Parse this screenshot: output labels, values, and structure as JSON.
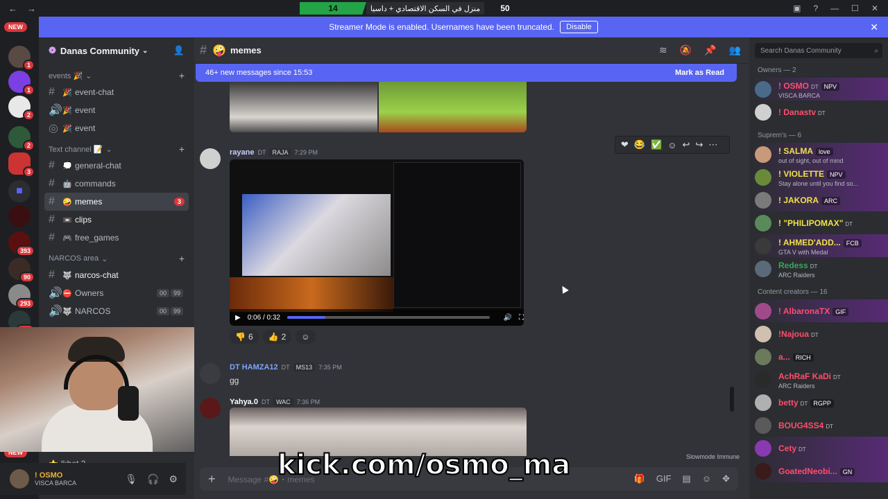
{
  "titlebar": {
    "score_left": "14",
    "stream_title": "منزل في السكن الاقتصادي + داسيا",
    "score_right": "50"
  },
  "banner": {
    "text": "Streamer Mode is enabled. Usernames have been truncated.",
    "disable_label": "Disable"
  },
  "servers": {
    "new_top": "NEW",
    "new_bottom": "NEW",
    "badges": [
      "1",
      "1",
      "2",
      "2",
      "3",
      "393",
      "90",
      "293",
      "230"
    ]
  },
  "guild": {
    "name": "Danas Community",
    "categories": [
      {
        "label": "events 🎉",
        "channels": [
          {
            "name": "event-chat",
            "emoji": "🎉",
            "type": "text"
          },
          {
            "name": "event",
            "emoji": "🎉",
            "type": "voice"
          },
          {
            "name": "event",
            "emoji": "🎉",
            "type": "stage"
          }
        ]
      },
      {
        "label": "Text channel 📝",
        "channels": [
          {
            "name": "general-chat",
            "emoji": "💭",
            "type": "text"
          },
          {
            "name": "commands",
            "emoji": "🤖",
            "type": "text"
          },
          {
            "name": "memes",
            "emoji": "🤪",
            "type": "text",
            "mention": "3"
          },
          {
            "name": "clips",
            "emoji": "📼",
            "type": "text"
          },
          {
            "name": "free_games",
            "emoji": "🎮",
            "type": "text"
          }
        ]
      },
      {
        "label": "NARCOS area",
        "channels": [
          {
            "name": "narcos-chat",
            "emoji": "🐺",
            "type": "text"
          },
          {
            "name": "Owners",
            "emoji": "⛔",
            "type": "voice",
            "users": "00",
            "limit": "99"
          },
          {
            "name": "NARCOS",
            "emoji": "🐺",
            "type": "voice",
            "users": "00",
            "limit": "99"
          }
        ]
      }
    ],
    "bottom_channel": "lkhot 2"
  },
  "user_panel": {
    "name": "! OSMO",
    "status": "VISCA BARCA"
  },
  "channel": {
    "name": "memes",
    "new_messages": "46+ new messages since 15:53",
    "mark_read": "Mark as Read"
  },
  "messages": [
    {
      "author": "rayane",
      "suffix": "DT",
      "tag": "RAJA",
      "time": "7:29 PM",
      "author_color": "#c9cdfb"
    },
    {
      "author": "DT HAMZA12",
      "suffix": "DT",
      "tag": "MS13",
      "time": "7:35 PM",
      "text": "gg",
      "author_color": "#7ea6ff"
    },
    {
      "author": "Yahya.0",
      "suffix": "DT",
      "tag": "WAC",
      "time": "7:36 PM",
      "author_color": "#ffffff"
    }
  ],
  "video": {
    "time": "0:06 / 0:32",
    "progress": 0.19
  },
  "reactions": [
    {
      "emoji": "👎",
      "count": "6"
    },
    {
      "emoji": "👍",
      "count": "2"
    }
  ],
  "slowmode": "Slowmode Immune",
  "composer": {
    "placeholder": "Message #🤪・memes"
  },
  "overlay": {
    "kick": "kick.com/osmo_ma"
  },
  "members": {
    "search_placeholder": "Search Danas Community",
    "groups": [
      {
        "label": "Owners — 2",
        "items": [
          {
            "name": "! OSMO",
            "suffix": "DT",
            "tag": "NPV",
            "status": "VISCA BARCA",
            "color": "#ff4d6d",
            "glow": true
          },
          {
            "name": "! Danastv",
            "suffix": "DT",
            "color": "#ff4d6d"
          }
        ]
      },
      {
        "label": "Suprem's — 6",
        "items": [
          {
            "name": "! SALMA",
            "tag": "love",
            "status": "out of sight, out of mind",
            "color": "#f0e14a",
            "glow": true
          },
          {
            "name": "! VIOLETTE",
            "tag": "NPV",
            "status": "Stay alone until you find so...",
            "color": "#f0e14a",
            "glow": true
          },
          {
            "name": "! JAKORA",
            "tag": "ARC",
            "color": "#f0e14a",
            "glow": true
          },
          {
            "name": "! \"PHILIPOMAX\"",
            "suffix": "DT",
            "color": "#f0e14a"
          },
          {
            "name": "! AHMED'ADD...",
            "tag": "FCB",
            "status": "GTA V with Medal",
            "color": "#f0e14a",
            "glow": true
          },
          {
            "name": "Redess",
            "suffix": "DT",
            "status": "ARC Raiders",
            "color": "#3ba55c"
          }
        ]
      },
      {
        "label": "Content creators — 16",
        "items": [
          {
            "name": "! AlbaronaTX",
            "tag": "GIF",
            "color": "#ff4d6d",
            "glow": true
          },
          {
            "name": "!Najoua",
            "suffix": "DT",
            "color": "#ff4d6d"
          },
          {
            "name": "a...",
            "tag": "RICH",
            "color": "#ff4d6d"
          },
          {
            "name": "AchRaF KaDi",
            "suffix": "DT",
            "status": "ARC Raiders",
            "color": "#ff4d6d"
          },
          {
            "name": "betty",
            "suffix": "DT",
            "tag": "RGPP",
            "color": "#ff4d6d"
          },
          {
            "name": "BOUG4SS4",
            "suffix": "DT",
            "color": "#ff4d6d"
          },
          {
            "name": "Cety",
            "suffix": "DT",
            "color": "#ff4d6d",
            "glow": true
          },
          {
            "name": "GoatedNeobi...",
            "tag": "GN",
            "color": "#ff4d6d",
            "glow": true
          }
        ]
      }
    ]
  }
}
